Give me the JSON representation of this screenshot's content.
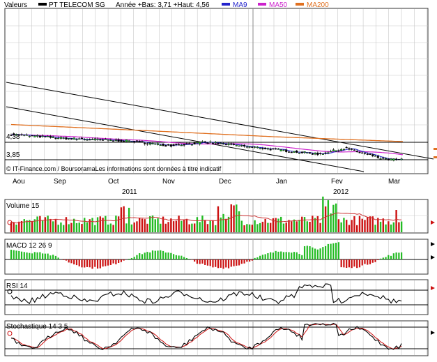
{
  "header": {
    "valeurs": "Valeurs",
    "name": "PT TELECOM SG",
    "stats": "Année +Bas: 3,71 +Haut: 4,56",
    "legend": [
      {
        "label": "MA9",
        "color": "#2222cc"
      },
      {
        "label": "MA50",
        "color": "#cc22cc"
      },
      {
        "label": "MA200",
        "color": "#e07020"
      }
    ]
  },
  "price_panel": {
    "level_labels": [
      "4,38",
      "3,85"
    ],
    "copyright": "© IT-Finance.com / BoursoramaLes informations sont données à titre indicatif"
  },
  "time_axis": {
    "months": [
      "Aou",
      "Sep",
      "Oct",
      "Nov",
      "Dec",
      "Jan",
      "Fev",
      "Mar"
    ],
    "years": [
      "2011",
      "2012"
    ]
  },
  "indicators": {
    "volume": "Volume 15",
    "macd": "MACD 12 26 9",
    "rsi": "RSI 14",
    "stochastic": "Stochastique 14 3 5"
  },
  "colors": {
    "up": "#22bb22",
    "down": "#cc1111",
    "grid": "#c8c8c8",
    "border": "#333333",
    "ma200": "#e07020",
    "ma50": "#cc22cc",
    "ma9": "#2222cc"
  },
  "chart_data": {
    "type": "candlestick",
    "ma200": [
      [
        0,
        4.92
      ],
      [
        100,
        4.74
      ],
      [
        200,
        4.55
      ],
      [
        300,
        4.4
      ]
    ],
    "ma50_window": 50,
    "ma9_window": 9,
    "price_levels": [
      4.38,
      3.85
    ]
  }
}
